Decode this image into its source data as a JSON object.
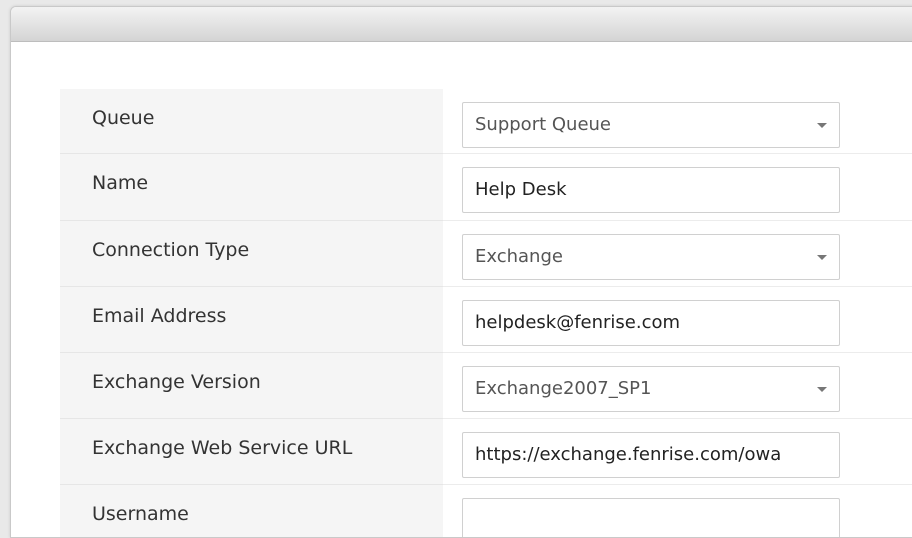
{
  "form": {
    "queue": {
      "label": "Queue",
      "value": "Support Queue"
    },
    "name": {
      "label": "Name",
      "value": "Help Desk"
    },
    "connection_type": {
      "label": "Connection Type",
      "value": "Exchange"
    },
    "email_address": {
      "label": "Email Address",
      "value": "helpdesk@fenrise.com"
    },
    "exchange_version": {
      "label": "Exchange Version",
      "value": "Exchange2007_SP1"
    },
    "ews_url": {
      "label": "Exchange Web Service URL",
      "value": "https://exchange.fenrise.com/owa"
    },
    "username": {
      "label": "Username",
      "value": ""
    }
  },
  "icons": {
    "dropdown": "chevron-down-icon"
  }
}
